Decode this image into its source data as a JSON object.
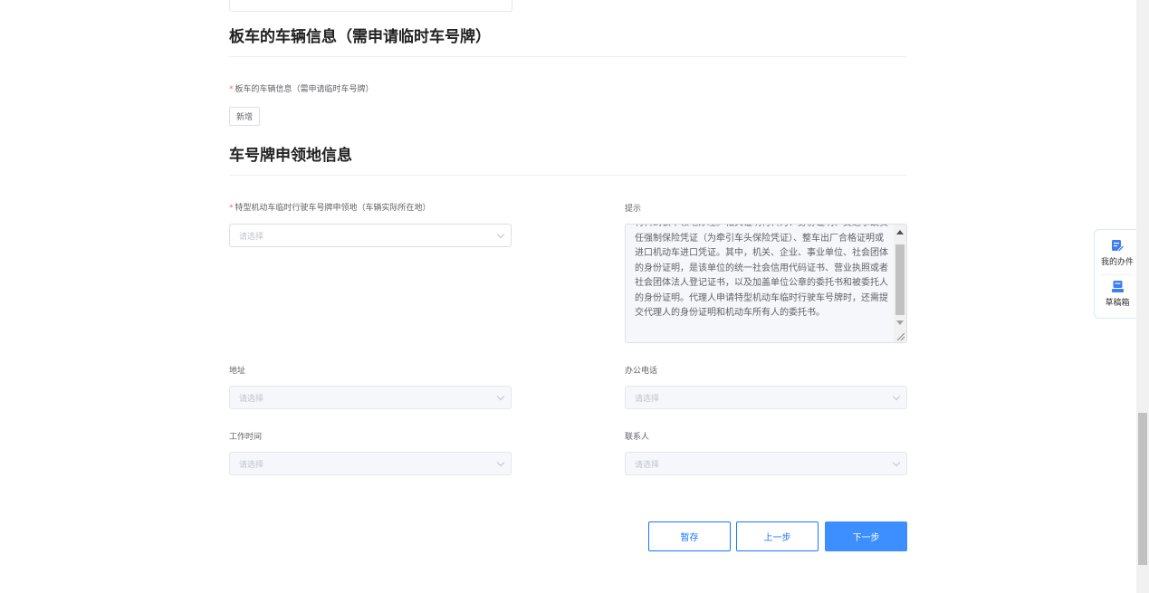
{
  "trailer_section": {
    "title": "板车的车辆信息（需申请临时车号牌）",
    "field_label": "板车的车辆信息（需申请临时车号牌）",
    "add_button": "新增"
  },
  "plate_section": {
    "title": "车号牌申领地信息",
    "location_label": "特型机动车临时行驶车号牌申领地（车辆实际所在地）",
    "location_placeholder": "请选择",
    "tip_label": "提示",
    "tip_text": "材料到该申领地办理。相关证明材料为：身份证明、交通事故责任强制保险凭证（为牵引车头保险凭证）、整车出厂合格证明或进口机动车进口凭证。其中，机关、企业、事业单位、社会团体的身份证明，是该单位的统一社会信用代码证书、营业执照或者社会团体法人登记证书，以及加盖单位公章的委托书和被委托人的身份证明。代理人申请特型机动车临时行驶车号牌时，还需提交代理人的身份证明和机动车所有人的委托书。",
    "address_label": "地址",
    "address_placeholder": "请选择",
    "phone_label": "办公电话",
    "phone_placeholder": "请选择",
    "hours_label": "工作时间",
    "hours_placeholder": "请选择",
    "contact_label": "联系人",
    "contact_placeholder": "请选择"
  },
  "actions": {
    "save": "暂存",
    "prev": "上一步",
    "next": "下一步"
  },
  "float_panel": {
    "my_items": "我的办件",
    "drafts": "草稿箱"
  },
  "colors": {
    "primary": "#3d8eff",
    "required": "#f56c6c",
    "float_icon": "#3d7ef0"
  },
  "icons": {
    "my_items": "edit-document-icon",
    "drafts": "drafts-box-icon"
  }
}
